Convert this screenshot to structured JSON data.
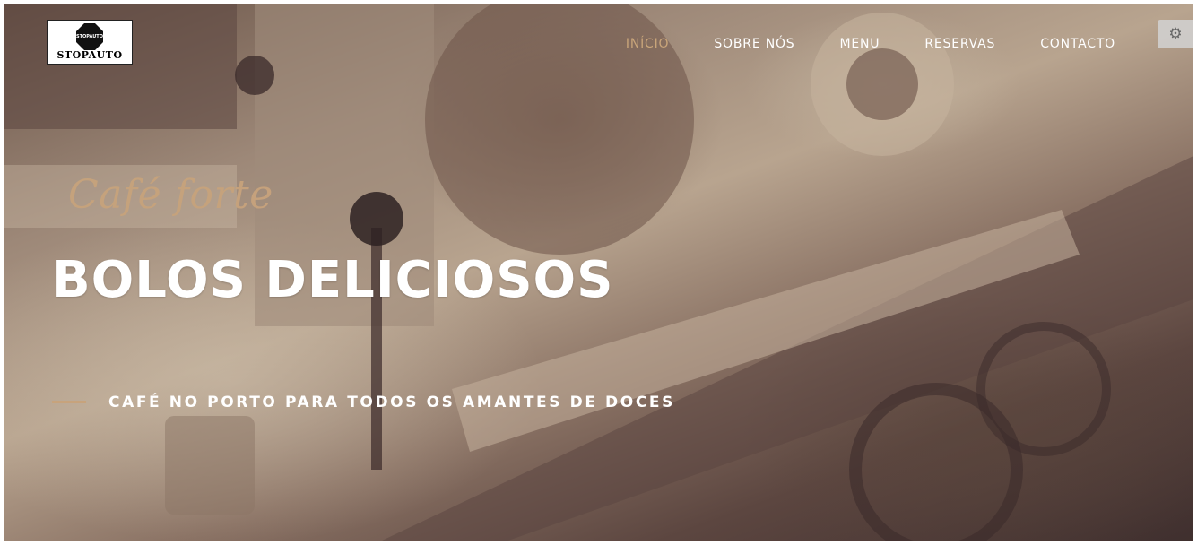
{
  "brand": {
    "logo_sign_text": "STOPAUTO",
    "logo_word": "STOPAUTO"
  },
  "nav": {
    "items": [
      {
        "label": "INÍCIO",
        "active": true
      },
      {
        "label": "SOBRE NÓS",
        "active": false
      },
      {
        "label": "MENU",
        "active": false
      },
      {
        "label": "RESERVAS",
        "active": false
      },
      {
        "label": "CONTACTO",
        "active": false
      }
    ],
    "active_color": "#c9a57a"
  },
  "settings": {
    "icon": "gear-icon"
  },
  "hero": {
    "script_text": "Café forte",
    "headline": "BOLOS DELICIOSOS",
    "subtitle": "CAFÉ NO PORTO PARA TODOS OS AMANTES DE DOCES",
    "accent_color": "#c7a37c"
  }
}
